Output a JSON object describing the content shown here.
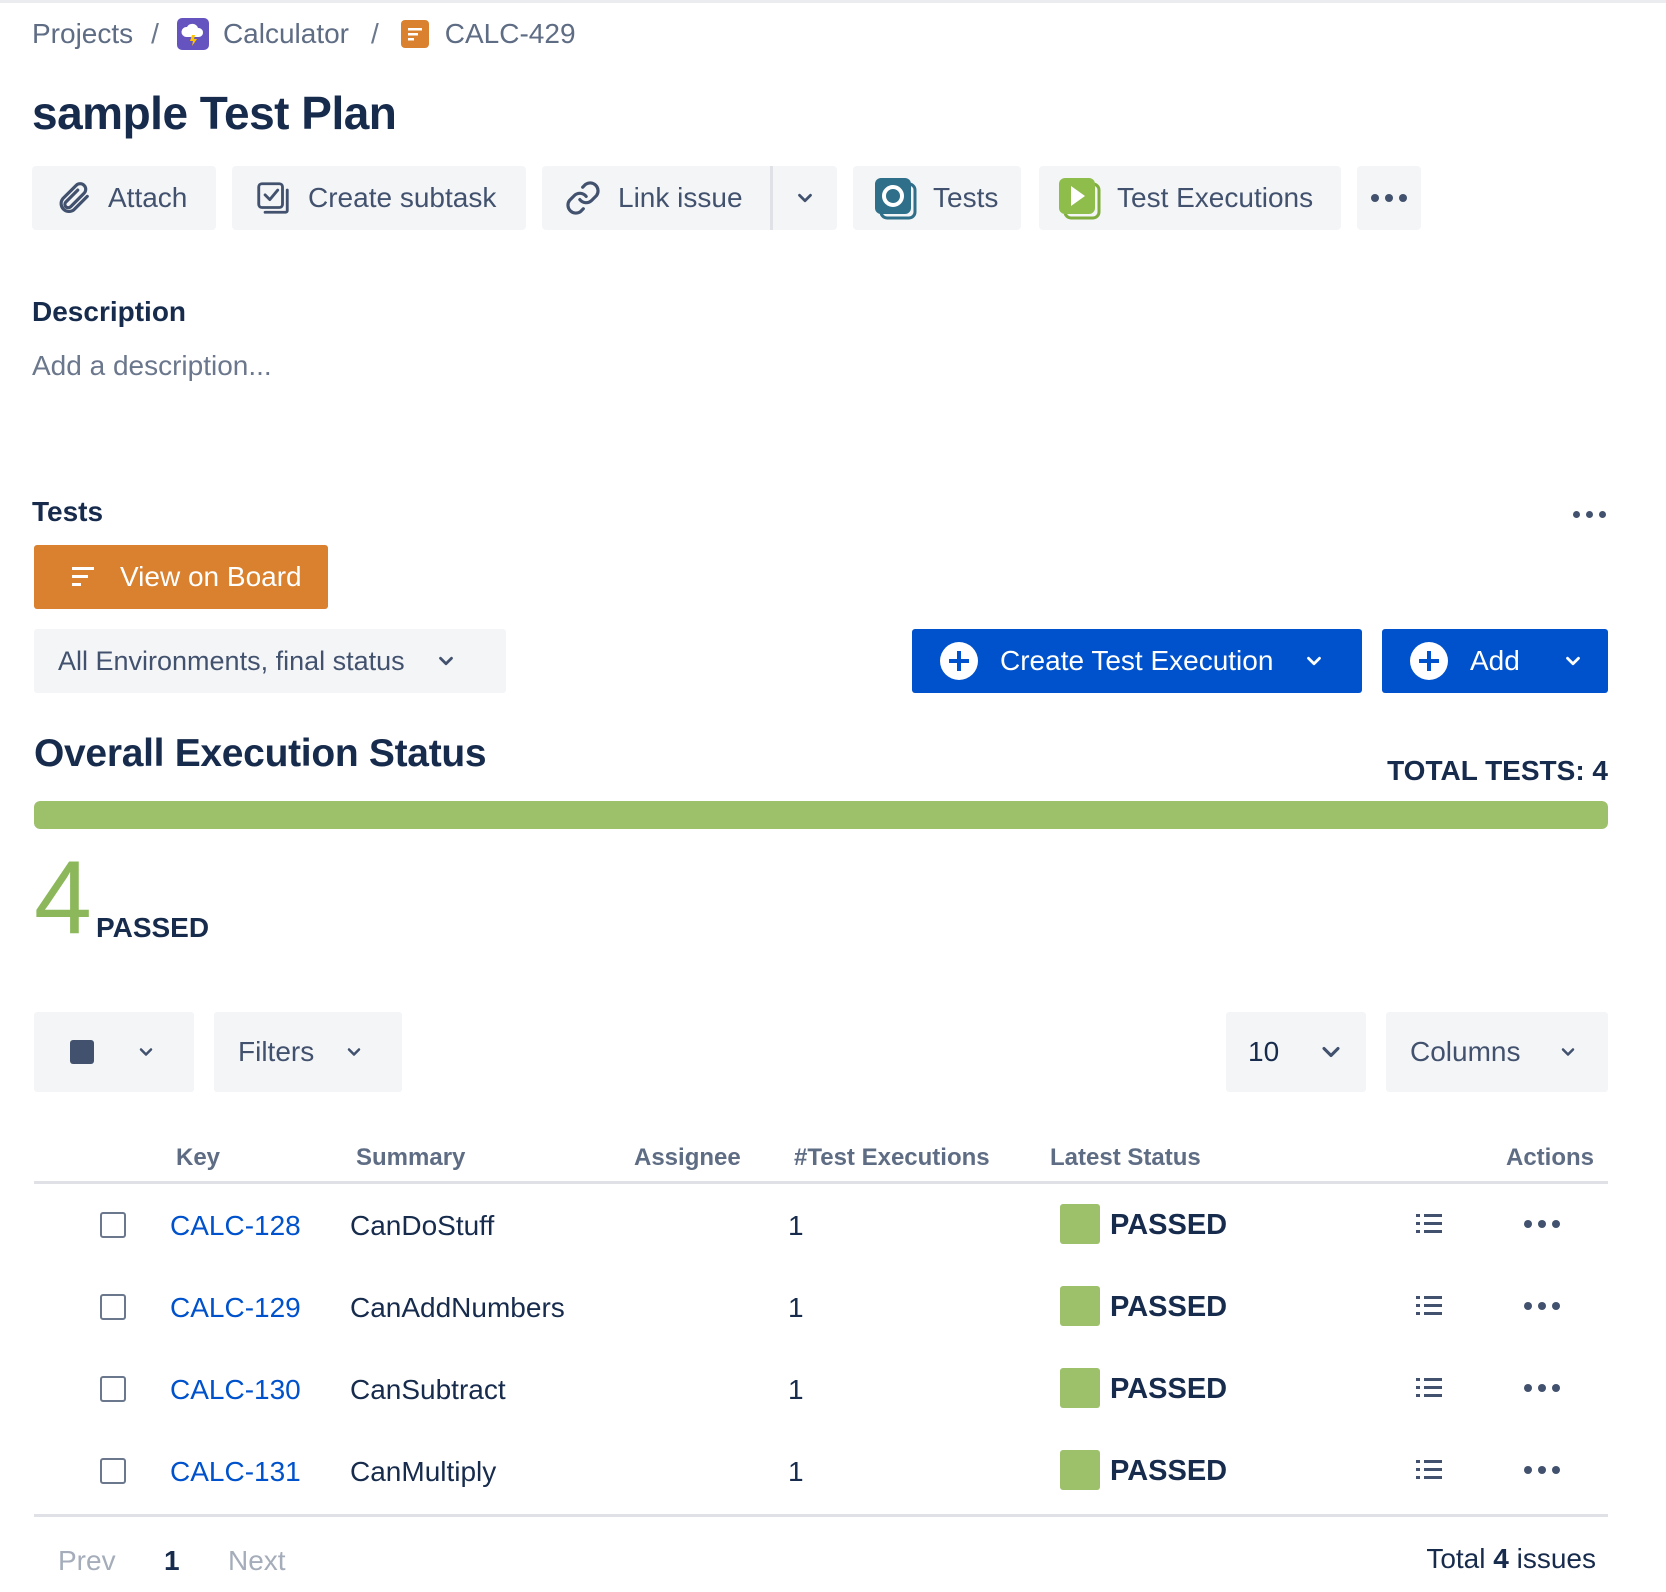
{
  "breadcrumb": {
    "projects": "Projects",
    "project": "Calculator",
    "issue": "CALC-429",
    "separator": "/"
  },
  "page_title": "sample Test Plan",
  "toolbar": {
    "attach": "Attach",
    "create_subtask": "Create subtask",
    "link_issue": "Link issue",
    "tests": "Tests",
    "test_executions": "Test Executions"
  },
  "description": {
    "heading": "Description",
    "placeholder": "Add a description..."
  },
  "tests_section": {
    "heading": "Tests",
    "view_on_board": "View on Board",
    "environment_filter": "All Environments, final status",
    "create_test_execution": "Create Test Execution",
    "add": "Add"
  },
  "overall": {
    "heading": "Overall Execution Status",
    "total_tests": "TOTAL TESTS: 4",
    "passed_fraction": 1.0,
    "passed_count": "4",
    "passed_label": "PASSED"
  },
  "table_controls": {
    "filters": "Filters",
    "page_size": "10",
    "columns": "Columns"
  },
  "table": {
    "headers": {
      "key": "Key",
      "summary": "Summary",
      "assignee": "Assignee",
      "test_executions": "#Test Executions",
      "latest_status": "Latest Status",
      "actions": "Actions"
    },
    "rows": [
      {
        "key": "CALC-128",
        "summary": "CanDoStuff",
        "assignee": "",
        "executions": "1",
        "status": "PASSED"
      },
      {
        "key": "CALC-129",
        "summary": "CanAddNumbers",
        "assignee": "",
        "executions": "1",
        "status": "PASSED"
      },
      {
        "key": "CALC-130",
        "summary": "CanSubtract",
        "assignee": "",
        "executions": "1",
        "status": "PASSED"
      },
      {
        "key": "CALC-131",
        "summary": "CanMultiply",
        "assignee": "",
        "executions": "1",
        "status": "PASSED"
      }
    ]
  },
  "pagination": {
    "prev": "Prev",
    "current": "1",
    "next": "Next",
    "total_prefix": "Total",
    "total_count": "4",
    "total_suffix": "issues"
  },
  "colors": {
    "accent_blue": "#0052cc",
    "orange": "#d9812f",
    "passed_green": "#9dc06b"
  }
}
